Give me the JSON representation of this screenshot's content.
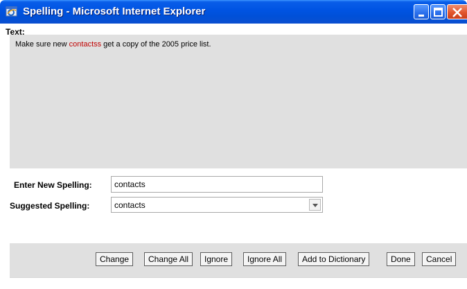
{
  "window": {
    "title": "Spelling - Microsoft Internet Explorer"
  },
  "text_section": {
    "label": "Text:",
    "before": "Make sure new ",
    "misspelled": "contactss",
    "after": " get a copy of the 2005 price list."
  },
  "form": {
    "new_spelling_label": "Enter New Spelling:",
    "new_spelling_value": "contacts",
    "suggested_label": "Suggested Spelling:",
    "suggested_value": "contacts"
  },
  "buttons": {
    "change": "Change",
    "change_all": "Change All",
    "ignore": "Ignore",
    "ignore_all": "Ignore All",
    "add_to_dictionary": "Add to Dictionary",
    "done": "Done",
    "cancel": "Cancel"
  },
  "colors": {
    "misspelled": "#c00000",
    "titlebar": "#0054e3",
    "panel": "#e0e0e0"
  },
  "icons": [
    "ie-window-icon",
    "minimize-icon",
    "maximize-icon",
    "close-icon",
    "dropdown-arrow-icon"
  ]
}
